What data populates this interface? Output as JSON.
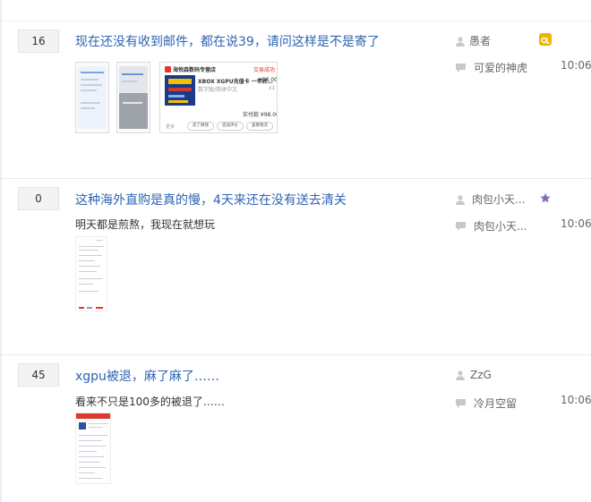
{
  "threads": [
    {
      "replies": "16",
      "title": "现在还没有收到邮件，都在说39，请问这样是不是寄了",
      "excerpt": "",
      "author": "愚者",
      "last_reply": "可爱的神虎",
      "time": "10:06",
      "badge": {
        "icon": "member-badge-icon",
        "color": "#f0b400"
      },
      "images": {
        "ad": {
          "shop": "海悦森数码专营店",
          "status": "交易成功",
          "product": "XBOX XGPU充值卡 一年终…",
          "price": "¥98.00",
          "variant": "数字版/简体中文",
          "qty": "x1",
          "paid": "实付款 ¥98.00",
          "more": "更多",
          "btn1": "卖了换钱",
          "btn2": "追加评价",
          "btn3": "查看物流"
        }
      }
    },
    {
      "replies": "0",
      "title": "这种海外直购是真的慢，4天来还在没有送去清关",
      "excerpt": "明天都是煎熬，我现在就想玩",
      "author": "肉包小天...",
      "last_reply": "肉包小天...",
      "time": "10:06",
      "badge": {
        "icon": "shield-badge-icon",
        "color": "#6a7fd8"
      }
    },
    {
      "replies": "45",
      "title": "xgpu被退，麻了麻了……",
      "excerpt": "看来不只是100多的被退了……",
      "author": "ZzG",
      "last_reply": "冷月空留",
      "time": "10:06",
      "badge": null
    }
  ],
  "colors": {
    "link": "#2d64b3",
    "meta": "#666666",
    "reply_bg": "#f3f3f3"
  }
}
